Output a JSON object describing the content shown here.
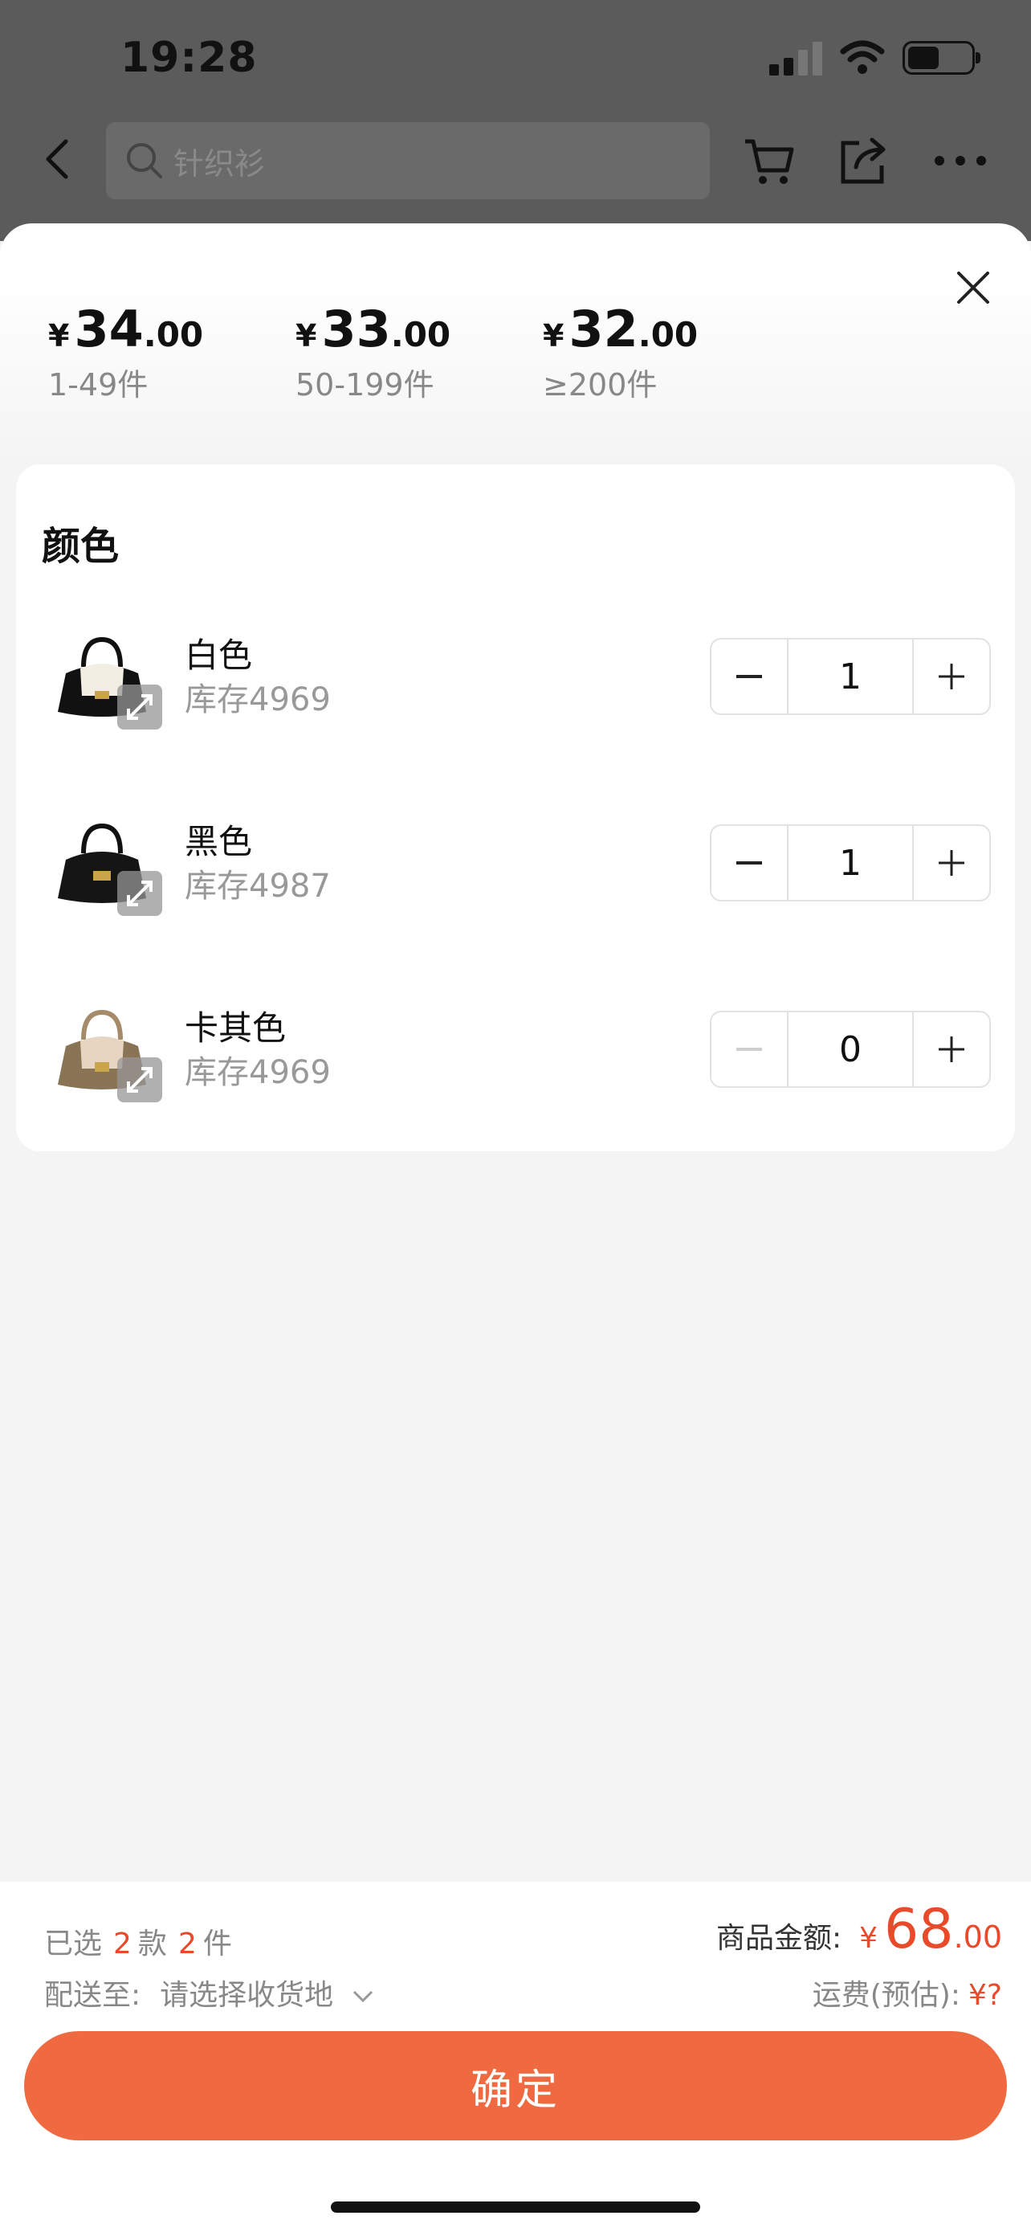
{
  "status_bar": {
    "time": "19:28"
  },
  "top_nav": {
    "search_placeholder": "针织衫"
  },
  "price_tiers": [
    {
      "currency": "¥",
      "int": "34",
      "dec": ".00",
      "range": "1-49件"
    },
    {
      "currency": "¥",
      "int": "33",
      "dec": ".00",
      "range": "50-199件"
    },
    {
      "currency": "¥",
      "int": "32",
      "dec": ".00",
      "range": "≥200件"
    }
  ],
  "color_section": {
    "title": "颜色",
    "variants": [
      {
        "name": "白色",
        "stock": "库存4969",
        "qty": "1"
      },
      {
        "name": "黑色",
        "stock": "库存4987",
        "qty": "1"
      },
      {
        "name": "卡其色",
        "stock": "库存4969",
        "qty": "0"
      }
    ]
  },
  "summary": {
    "selected_prefix": "已选",
    "styles_count": "2",
    "styles_unit": "款",
    "items_count": "2",
    "items_unit": "件",
    "ship_label": "配送至:",
    "ship_value": "请选择收货地",
    "goods_label": "商品金额:",
    "goods_currency": "¥",
    "goods_int": "68",
    "goods_dec": ".00",
    "freight_label": "运费(预估):",
    "freight_value": "¥?",
    "confirm": "确定"
  },
  "colors": {
    "accent": "#ef6a41",
    "price_red": "#e84a2a"
  }
}
